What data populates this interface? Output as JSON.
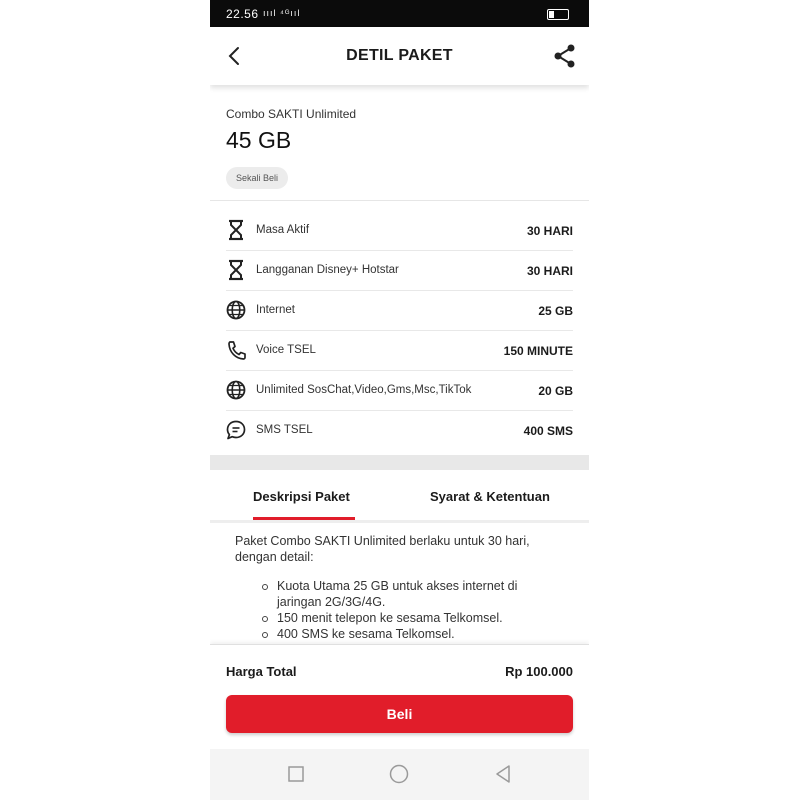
{
  "status_bar": {
    "time": "22.56",
    "signal": "ıııl ⁴ᴳııl"
  },
  "app_bar": {
    "title": "DETIL PAKET",
    "back_icon": "chevron-left-icon",
    "share_icon": "share-icon"
  },
  "package": {
    "name": "Combo SAKTI Unlimited",
    "size": "45 GB",
    "badge": "Sekali Beli"
  },
  "details": [
    {
      "icon": "hourglass-icon",
      "label": "Masa Aktif",
      "value": "30 HARI"
    },
    {
      "icon": "hourglass-icon",
      "label": "Langganan Disney+ Hotstar",
      "value": "30 HARI"
    },
    {
      "icon": "globe-icon",
      "label": "Internet",
      "value": "25 GB"
    },
    {
      "icon": "phone-icon",
      "label": "Voice TSEL",
      "value": "150 MINUTE"
    },
    {
      "icon": "globe-icon",
      "label": "Unlimited SosChat,Video,Gms,Msc,TikTok",
      "value": "20 GB"
    },
    {
      "icon": "chat-icon",
      "label": "SMS TSEL",
      "value": "400 SMS"
    }
  ],
  "tabs": [
    {
      "label": "Deskripsi Paket",
      "active": true
    },
    {
      "label": "Syarat & Ketentuan",
      "active": false
    }
  ],
  "description": {
    "intro": "Paket Combo SAKTI Unlimited berlaku untuk 30 hari, dengan detail:",
    "items": [
      "Kuota Utama 25 GB untuk akses internet di jaringan 2G/3G/4G.",
      "150 menit telepon ke sesama Telkomsel.",
      "400 SMS ke sesama Telkomsel."
    ]
  },
  "footer": {
    "total_label": "Harga Total",
    "total_value": "Rp 100.000",
    "buy_label": "Beli"
  },
  "colors": {
    "accent": "#e11d2a",
    "status_bar": "#0b0b0b"
  }
}
